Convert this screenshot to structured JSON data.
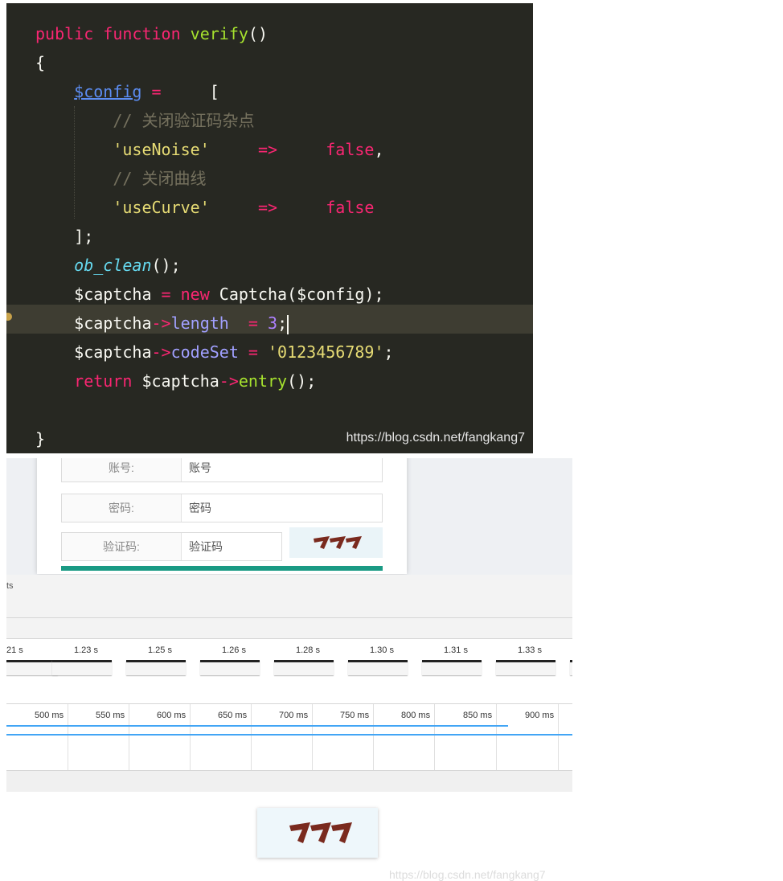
{
  "editor": {
    "lines": [
      {
        "t": [
          [
            "kw",
            "public "
          ],
          [
            "kw",
            "function "
          ],
          [
            "fn",
            "verify"
          ],
          [
            "",
            "()"
          ]
        ]
      },
      {
        "t": [
          [
            "",
            "{"
          ]
        ]
      },
      {
        "t": [
          [
            "",
            "    "
          ],
          [
            "var",
            "$config"
          ],
          [
            "kw",
            " = "
          ],
          [
            "",
            "    ["
          ]
        ]
      },
      {
        "t": [
          [
            "",
            "        "
          ],
          [
            "cmt",
            "// 关闭验证码杂点"
          ]
        ]
      },
      {
        "t": [
          [
            "",
            "        "
          ],
          [
            "str",
            "'useNoise'"
          ],
          [
            "kw",
            "     =>     "
          ],
          [
            "kw",
            "false"
          ],
          [
            "",
            ","
          ]
        ]
      },
      {
        "t": [
          [
            "",
            "        "
          ],
          [
            "cmt",
            "// 关闭曲线"
          ]
        ]
      },
      {
        "t": [
          [
            "",
            "        "
          ],
          [
            "str",
            "'useCurve'"
          ],
          [
            "kw",
            "     =>     "
          ],
          [
            "kw",
            "false"
          ]
        ]
      },
      {
        "t": [
          [
            "",
            "    ];"
          ]
        ]
      },
      {
        "t": [
          [
            "",
            "    "
          ],
          [
            "call",
            "ob_clean"
          ],
          [
            "",
            "();"
          ]
        ]
      },
      {
        "t": [
          [
            "",
            "    $captcha "
          ],
          [
            "kw",
            "= new "
          ],
          [
            "",
            "Captcha($config);"
          ]
        ]
      },
      {
        "t": [
          [
            "",
            "    $captcha"
          ],
          [
            "kw",
            "->"
          ],
          [
            "prop",
            "length"
          ],
          [
            "kw",
            "  = "
          ],
          [
            "num",
            "3"
          ],
          [
            "",
            ";"
          ]
        ],
        "cursor": true
      },
      {
        "t": [
          [
            "",
            "    $captcha"
          ],
          [
            "kw",
            "->"
          ],
          [
            "prop",
            "codeSet"
          ],
          [
            "kw",
            " = "
          ],
          [
            "str",
            "'0123456789'"
          ],
          [
            "",
            ";"
          ]
        ]
      },
      {
        "t": [
          [
            "",
            "    "
          ],
          [
            "kw",
            "return "
          ],
          [
            "",
            "$captcha"
          ],
          [
            "kw",
            "->"
          ],
          [
            "fn",
            "entry"
          ],
          [
            "",
            "();"
          ]
        ]
      },
      {
        "t": [
          [
            "",
            ""
          ]
        ]
      },
      {
        "t": [
          [
            "",
            "}"
          ]
        ]
      }
    ],
    "watermark": "https://blog.csdn.net/fangkang7"
  },
  "login": {
    "account_label": "账号:",
    "account_placeholder": "账号",
    "password_label": "密码:",
    "password_placeholder": "密码",
    "captcha_label": "验证码:",
    "captcha_placeholder": "验证码",
    "captcha_value": "777"
  },
  "devtools": {
    "tab_fragment": "ts",
    "second_ticks": [
      "21 s",
      "1.23 s",
      "1.25 s",
      "1.26 s",
      "1.28 s",
      "1.30 s",
      "1.31 s",
      "1.33 s"
    ],
    "ms_ticks": [
      "500 ms",
      "550 ms",
      "600 ms",
      "650 ms",
      "700 ms",
      "750 ms",
      "800 ms",
      "850 ms",
      "900 ms"
    ]
  },
  "captcha_large": {
    "value": "777"
  },
  "watermark_bottom": "https://blog.csdn.net/fangkang7",
  "colors": {
    "editor_bg": "#272822",
    "keyword": "#f92672",
    "string": "#e6db74",
    "function": "#a6e22e",
    "accent_bar": "#1a9a84",
    "timeline_line": "#42a5f5"
  }
}
